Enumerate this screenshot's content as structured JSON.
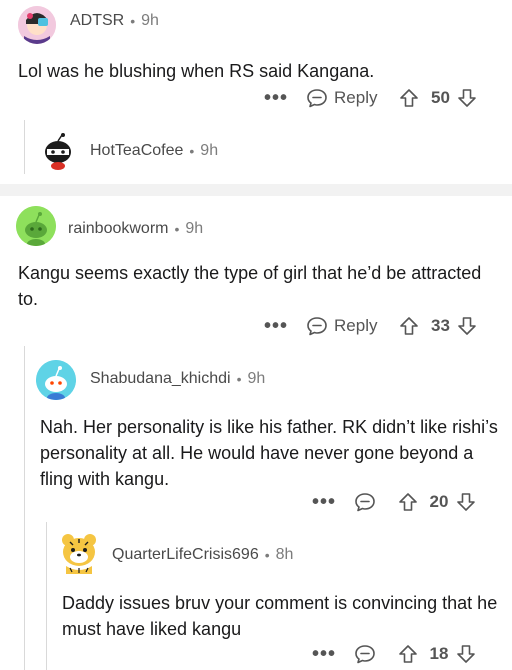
{
  "comments": [
    {
      "user": "ADTSR",
      "age": "9h",
      "text": "Lol was he blushing when RS said Kangana.",
      "reply_label": "Reply",
      "score": "50",
      "avatar_icon": "anime-character-avatar"
    },
    {
      "user": "HotTeaCofee",
      "age": "9h",
      "avatar_icon": "snoo-ninja-avatar"
    },
    {
      "user": "rainbookworm",
      "age": "9h",
      "text": "Kangu seems exactly the type of girl that he’d be attracted to.",
      "reply_label": "Reply",
      "score": "33",
      "avatar_icon": "snoo-green-avatar"
    },
    {
      "user": "Shabudana_khichdi",
      "age": "9h",
      "text": "Nah. Her personality is like his father. RK didn’t like rishi’s personality at all. He would have never gone beyond a fling with kangu.",
      "score": "20",
      "avatar_icon": "snoo-cyan-avatar"
    },
    {
      "user": "QuarterLifeCrisis696",
      "age": "8h",
      "text": "Daddy issues bruv your comment is convincing that he must have liked kangu",
      "score": "18",
      "avatar_icon": "tiger-avatar"
    }
  ],
  "common": {
    "dot": "•",
    "more": "•••"
  },
  "colors": {
    "muted": "#7c7c7c",
    "icon": "#555555",
    "separator": "#f2f2f2",
    "thread": "#d9d9d9"
  }
}
